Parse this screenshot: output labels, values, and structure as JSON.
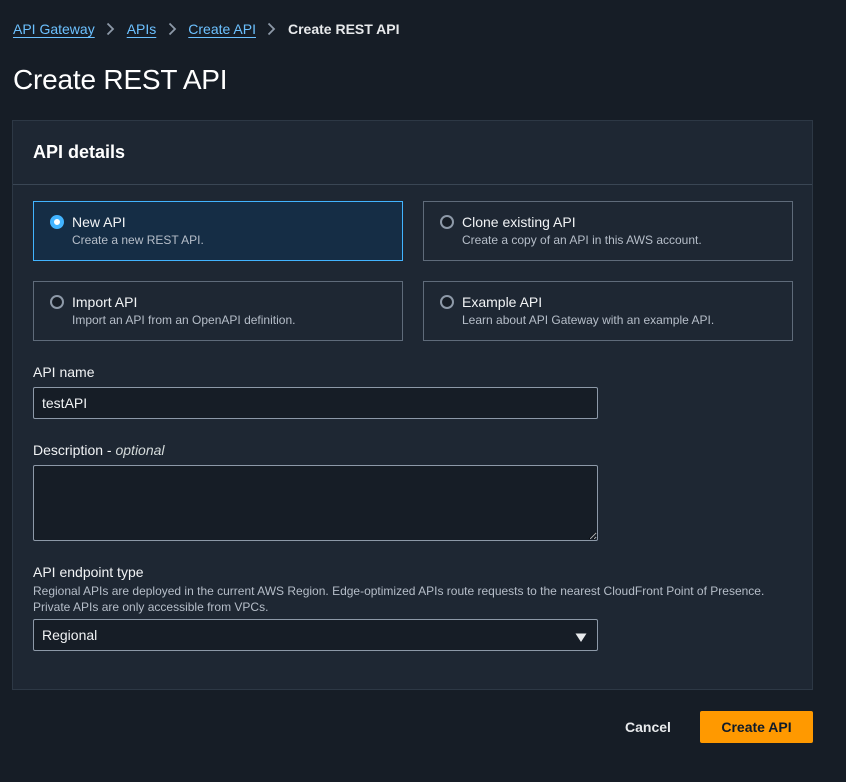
{
  "breadcrumb": {
    "items": [
      "API Gateway",
      "APIs",
      "Create API"
    ],
    "current": "Create REST API"
  },
  "page_title": "Create REST API",
  "panel": {
    "title": "API details",
    "options": [
      {
        "label": "New API",
        "description": "Create a new REST API.",
        "selected": true
      },
      {
        "label": "Clone existing API",
        "description": "Create a copy of an API in this AWS account.",
        "selected": false
      },
      {
        "label": "Import API",
        "description": "Import an API from an OpenAPI definition.",
        "selected": false
      },
      {
        "label": "Example API",
        "description": "Learn about API Gateway with an example API.",
        "selected": false
      }
    ],
    "api_name": {
      "label": "API name",
      "value": "testAPI"
    },
    "description": {
      "label": "Description",
      "optional": "optional",
      "value": ""
    },
    "endpoint_type": {
      "label": "API endpoint type",
      "hint": "Regional APIs are deployed in the current AWS Region. Edge-optimized APIs route requests to the nearest CloudFront Point of Presence. Private APIs are only accessible from VPCs.",
      "value": "Regional"
    }
  },
  "footer": {
    "cancel_label": "Cancel",
    "create_label": "Create API"
  },
  "colors": {
    "background": "#161d26",
    "panel": "#1e2733",
    "link": "#6cc1ff",
    "selected_border": "#42b4ff",
    "primary_button": "#ff9900"
  }
}
